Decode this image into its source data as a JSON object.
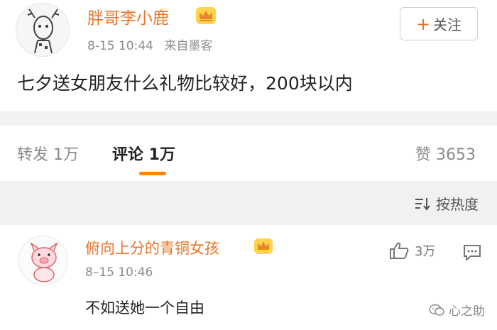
{
  "post": {
    "username": "胖哥李小鹿",
    "time": "8-15 10:44",
    "source": "来自墨客",
    "follow_label": "关注",
    "text": "七夕送女朋友什么礼物比较好，200块以内"
  },
  "tabs": {
    "repost": "转发 1万",
    "comment": "评论 1万",
    "like": "赞 3653"
  },
  "sort": {
    "label": "按热度"
  },
  "comment": {
    "username": "俯向上分的青铜女孩",
    "time": "8–15 10:46",
    "text": "不如送她一个自由",
    "like_count": "3万"
  },
  "watermark": {
    "label": "心之助"
  },
  "colors": {
    "accent": "#e8752a",
    "tab_underline": "#ff8200",
    "band": "#f1f1f1"
  }
}
